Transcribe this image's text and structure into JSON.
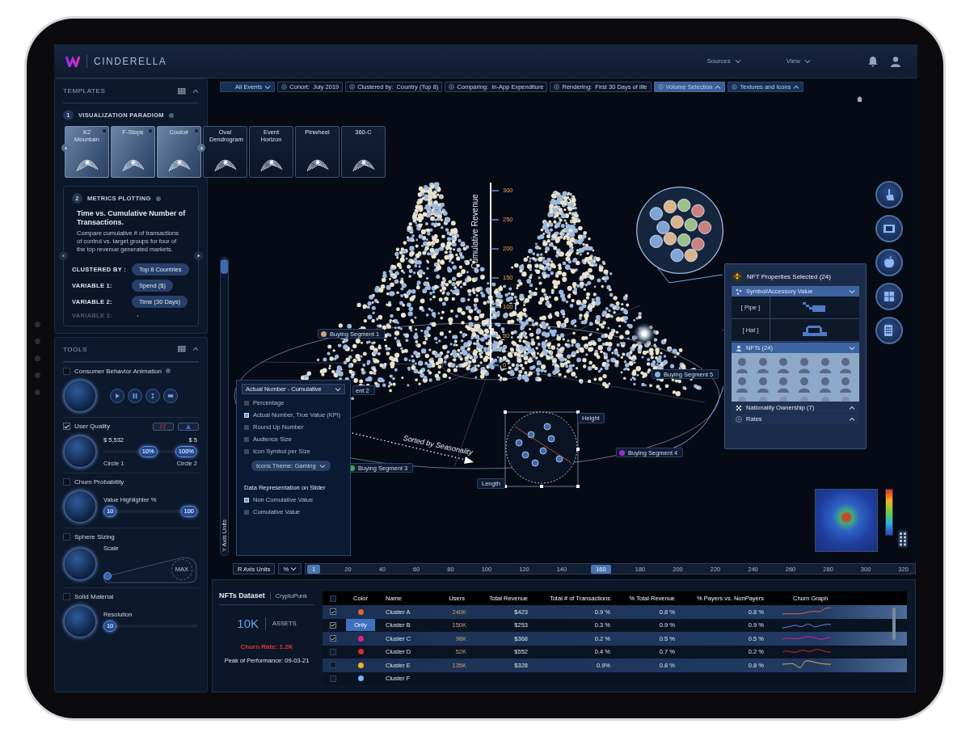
{
  "header": {
    "brand": "CINDERELLA",
    "menus": [
      {
        "label": "Sources"
      },
      {
        "label": "View"
      }
    ]
  },
  "templates": {
    "title": "TEMPLATES",
    "paradigm": {
      "number": "1",
      "title": "VISUALIZATION PARADIGM",
      "cards": [
        {
          "label": "K2 Mountain",
          "active": true
        },
        {
          "label": "F-Stops",
          "active": true
        },
        {
          "label": "Couloir",
          "active": true
        },
        {
          "label": "Oval Dendrogram",
          "active": false
        },
        {
          "label": "Event Horizon",
          "active": false
        },
        {
          "label": "Pinwheel",
          "active": false
        },
        {
          "label": "360-C",
          "active": false
        }
      ]
    },
    "metrics": {
      "number": "2",
      "title": "METRICS PLOTTING",
      "heading": "Time vs. Cumulative Number of Transactions.",
      "description": "Compare cumulative # of transactions of control vs. target groups for four of the top revenue generated markets.",
      "variables": [
        {
          "label": "CLUSTERED BY :",
          "value": "Top 8 Countries",
          "disabled": false
        },
        {
          "label": "VARIABLE 1:",
          "value": "Spend ($)",
          "disabled": false
        },
        {
          "label": "VARIABLE 2:",
          "value": "Time (30 Days)",
          "disabled": false
        },
        {
          "label": "VARIABLE 3:",
          "value": "•",
          "disabled": true
        }
      ]
    }
  },
  "tools": {
    "title": "TOOLS",
    "items": [
      {
        "kind": "animation",
        "label": "Consumer Behavior Animation",
        "checked": false
      },
      {
        "kind": "range",
        "label": "User Quality",
        "checked": true,
        "values": [
          "$ 5,532",
          "$ 5"
        ],
        "thumbs": [
          {
            "label": "10%",
            "level": 0.47
          },
          {
            "label": "100%",
            "level": 1
          }
        ],
        "captions": [
          "Circle 1",
          "Circle 2"
        ]
      },
      {
        "kind": "slider",
        "label": "Churn Probability",
        "checked": false,
        "caption": "Value Highlighter %",
        "thumbs": [
          {
            "label": "10",
            "level": 0
          },
          {
            "label": "100",
            "level": 1
          }
        ]
      },
      {
        "kind": "scale",
        "label": "Sphere Sizing",
        "checked": false,
        "caption": "Scale",
        "max": "MAX",
        "level": 0
      },
      {
        "kind": "slider",
        "label": "Solid Material",
        "checked": false,
        "caption": "Resolution",
        "thumbs": [
          {
            "label": "10",
            "level": 0
          }
        ]
      }
    ]
  },
  "filters": [
    {
      "kind": "dropdown",
      "label": "All Events",
      "expanded": false,
      "selected": false
    },
    {
      "kind": "chip",
      "label": "Cohort:",
      "value": "July 2019",
      "selected": false
    },
    {
      "kind": "chip",
      "label": "Clustered by:",
      "value": "Country (Top 8)",
      "selected": false
    },
    {
      "kind": "chip",
      "label": "Comparing:",
      "value": "In-App Expenditure",
      "selected": false
    },
    {
      "kind": "chip",
      "label": "Rendering:",
      "value": "First 30 Days of life",
      "selected": false
    },
    {
      "kind": "dropdown",
      "label": "Volume Selection",
      "expanded": true,
      "selected": true
    },
    {
      "kind": "dropdown",
      "label": "Textures and Icons",
      "expanded": true,
      "selected": false
    }
  ],
  "visualization": {
    "axis_title": "Cumulative Revenue",
    "axis_ticks": [
      "300",
      "250",
      "200",
      "150",
      "100",
      "50",
      "0"
    ],
    "segments": [
      {
        "label": "Buying Segment 1",
        "color": "#c9a47a"
      },
      {
        "label": "ent 2"
      },
      {
        "label": "Buying Segment 3",
        "color": "#3fae4a"
      },
      {
        "label": "Buying Segment 4",
        "color": "#9b2fc0"
      },
      {
        "label": "Buying Segment 5",
        "color": "#8fb3e0"
      }
    ],
    "annotation": "Sorted by Seasonality",
    "handles": [
      "Height",
      "Length"
    ]
  },
  "y_axis": {
    "label": "Y Axis Units",
    "level": 1
  },
  "value_menu": {
    "title": "Actual Number - Cumulative",
    "options": [
      {
        "label": "Percentage",
        "checked": false
      },
      {
        "label": "Actual Number, True Value (KPI)",
        "checked": true
      },
      {
        "label": "Round Up Number",
        "checked": false
      },
      {
        "label": "Audience Size",
        "checked": false
      },
      {
        "label": "Icon Symbol per Size",
        "checked": false
      }
    ],
    "theme_button": "Icons Theme: Gaming",
    "section": "Data Representation on Slider",
    "slider_options": [
      {
        "label": "Non Cumulative Value",
        "checked": true
      },
      {
        "label": "Cumulative Value",
        "checked": false
      }
    ]
  },
  "nft_panel": {
    "title": "NFT Properties Selected (24)",
    "sections": [
      {
        "kind": "accessories",
        "title": "Symbol/Accessory Value",
        "expanded": true,
        "rows": [
          "[ Pipe ]",
          "[ Hat ]"
        ]
      },
      {
        "kind": "avatars",
        "title": "NFTs (24)",
        "expanded": true
      },
      {
        "kind": "plain",
        "title": "Nationality Ownership (7)",
        "expanded": false
      },
      {
        "kind": "plain",
        "title": "Rates",
        "expanded": false
      }
    ]
  },
  "r_axis": {
    "label": "R Axis Units",
    "unit": "%",
    "ticks": [
      {
        "label": "1",
        "selected": true
      },
      {
        "label": "20",
        "selected": false
      },
      {
        "label": "40",
        "selected": false
      },
      {
        "label": "60",
        "selected": false
      },
      {
        "label": "80",
        "selected": false
      },
      {
        "label": "100",
        "selected": false
      },
      {
        "label": "120",
        "selected": false
      },
      {
        "label": "140",
        "selected": false
      },
      {
        "label": "160",
        "selected": true
      },
      {
        "label": "180",
        "selected": false
      },
      {
        "label": "200",
        "selected": false
      },
      {
        "label": "220",
        "selected": false
      },
      {
        "label": "240",
        "selected": false
      },
      {
        "label": "260",
        "selected": false
      },
      {
        "label": "280",
        "selected": false
      },
      {
        "label": "300",
        "selected": false
      },
      {
        "label": "320",
        "selected": false
      }
    ]
  },
  "dataset": {
    "title": "NFTs Dataset",
    "source": "CryptoPunk",
    "count": "10K",
    "count_label": "ASSETS",
    "churn": "Churn Rate: 1.2K",
    "peak": "Peak of Performance: 09-03-21"
  },
  "table": {
    "header_checked": false,
    "columns": [
      "Color",
      "Name",
      "Users",
      "Total Revenue",
      "Total # of Transactions",
      "% Total Revenue",
      "% Payers vs. NonPayers",
      "Churn Graph"
    ],
    "rows": [
      {
        "checked": true,
        "color": "#e0663a",
        "name": "Cluster A",
        "users": "240K",
        "revenue": "$423",
        "transactions": "0.9 %",
        "revenue_share": "0.8 %",
        "payers": "0.8 %"
      },
      {
        "checked": true,
        "only_button": "Only",
        "name": "Cluster B",
        "users": "150K",
        "revenue": "$253",
        "transactions": "0.3 %",
        "revenue_share": "0.9 %",
        "payers": "0.9 %"
      },
      {
        "checked": true,
        "color": "#e0208a",
        "name": "Cluster C",
        "users": "98K",
        "revenue": "$368",
        "transactions": "0.2 %",
        "revenue_share": "0.5 %",
        "payers": "0.5 %"
      },
      {
        "checked": false,
        "color": "#d42a22",
        "name": "Cluster D",
        "users": "52K",
        "revenue": "$552",
        "transactions": "0.4 %",
        "revenue_share": "0.7 %",
        "payers": "0.2 %"
      },
      {
        "checked": false,
        "color": "#e8b22a",
        "name": "Cluster E",
        "users": "135K",
        "revenue": "$328",
        "transactions": "0.9%",
        "revenue_share": "0.8 %",
        "payers": "0.8 %"
      },
      {
        "checked": false,
        "color": "#7ab4f0",
        "name": "Cluster F"
      }
    ]
  }
}
